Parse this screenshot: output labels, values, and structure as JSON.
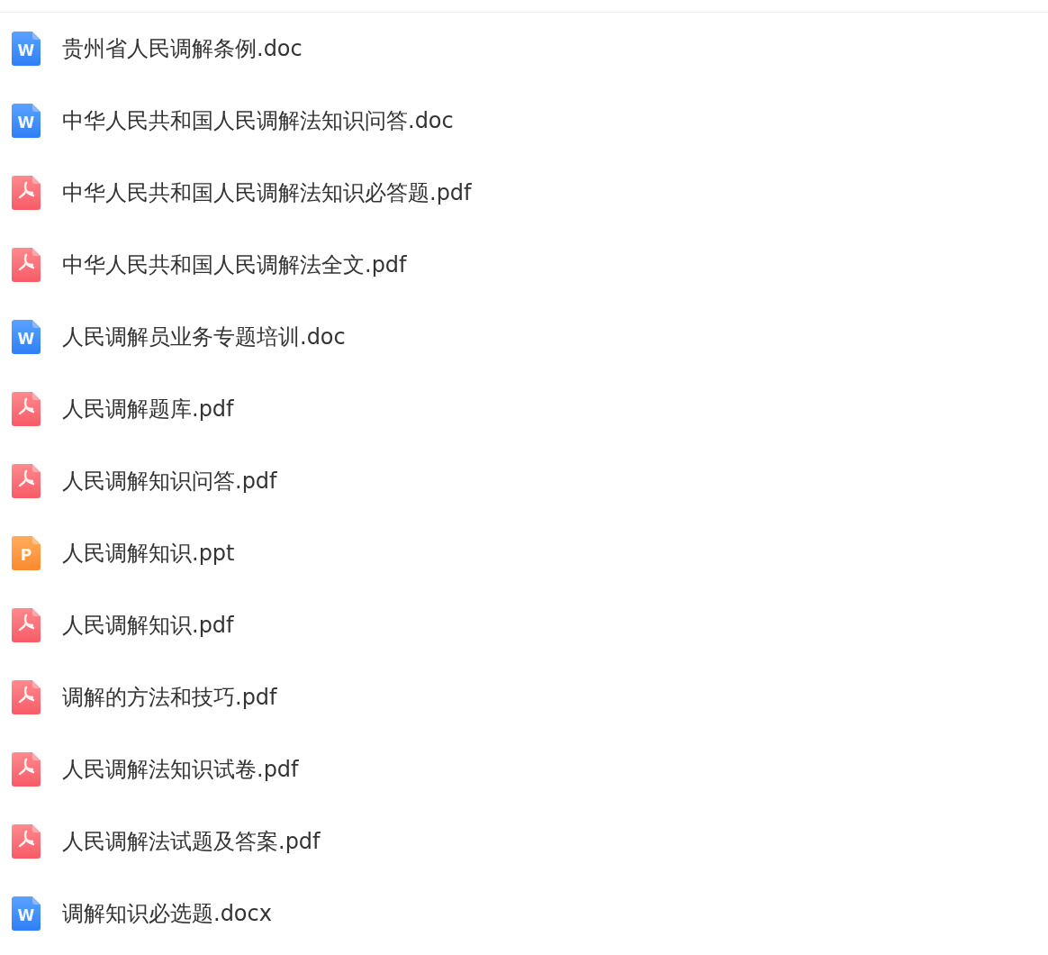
{
  "files": [
    {
      "kind": "doc",
      "icon_letter": "W",
      "name": "贵州省人民调解条例.doc"
    },
    {
      "kind": "doc",
      "icon_letter": "W",
      "name": "中华人民共和国人民调解法知识问答.doc"
    },
    {
      "kind": "pdf",
      "name": "中华人民共和国人民调解法知识必答题.pdf"
    },
    {
      "kind": "pdf",
      "name": "中华人民共和国人民调解法全文.pdf"
    },
    {
      "kind": "doc",
      "icon_letter": "W",
      "name": "人民调解员业务专题培训.doc"
    },
    {
      "kind": "pdf",
      "name": "人民调解题库.pdf"
    },
    {
      "kind": "pdf",
      "name": "人民调解知识问答.pdf"
    },
    {
      "kind": "ppt",
      "icon_letter": "P",
      "name": "人民调解知识.ppt"
    },
    {
      "kind": "pdf",
      "name": "人民调解知识.pdf"
    },
    {
      "kind": "pdf",
      "name": "调解的方法和技巧.pdf"
    },
    {
      "kind": "pdf",
      "name": "人民调解法知识试卷.pdf"
    },
    {
      "kind": "pdf",
      "name": "人民调解法试题及答案.pdf"
    },
    {
      "kind": "doc",
      "icon_letter": "W",
      "name": "调解知识必选题.docx"
    }
  ]
}
